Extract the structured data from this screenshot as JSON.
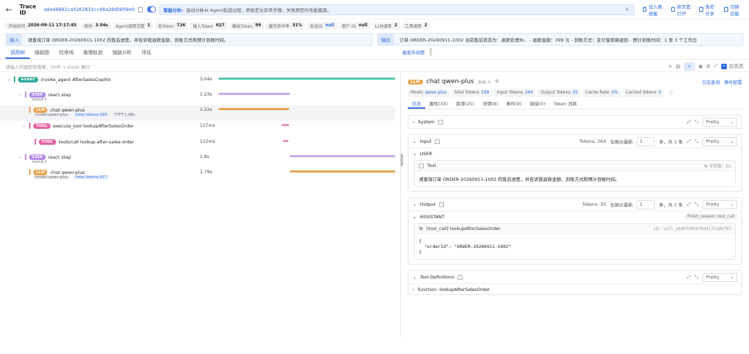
{
  "header": {
    "trace_label": "Trace ID",
    "trace_id": "a8a46682ca5162833cc06a28d5050e9",
    "ai_title": "智能分析:",
    "ai_text": "自动分析AI Agent轨迹过程，帮助定位异常步骤，失败原因与性能瓶颈。",
    "actions": [
      "加入数据集",
      "新页面打开",
      "免密分享",
      "切换旧版"
    ]
  },
  "stats": [
    {
      "label": "开始时间",
      "value": "2026-09-11 17:17:45"
    },
    {
      "label": "耗时",
      "value": "3.04s"
    },
    {
      "label": "Agent调用次数",
      "value": "1"
    },
    {
      "label": "总Token",
      "value": "726"
    },
    {
      "label": "输入Token",
      "value": "627"
    },
    {
      "label": "输出Token",
      "value": "99"
    },
    {
      "label": "缓存命中率",
      "value": "31%"
    },
    {
      "label": "会话ID",
      "value": "null"
    },
    {
      "label": "用户 ID",
      "value": "null"
    },
    {
      "label": "LLM调用",
      "value": "2"
    },
    {
      "label": "工具调用",
      "value": "2"
    }
  ],
  "io": {
    "input_tag": "输入",
    "input_text": "请查询订单 ORDER-20260911-1002 的售后进度，并告诉我退款金额、到账方式和预计到账时间。",
    "output_tag": "输出",
    "output_text": "订单 ORDER-20260911-1002 当前售后状态为：退款处理中。 - 退款金额：399 元 - 到账方式：支付宝原路退回 - 预计到账时间：1 至 3 个工作日"
  },
  "tabs": [
    "调用树",
    "链路图",
    "时序线",
    "推理轨迹",
    "链路分析",
    "评估"
  ],
  "tabs_right": "偏爱布视图",
  "search": {
    "placeholder": "请输入内容回车搜索，Shift + Enter 换行",
    "toggle_label": "仅高亮"
  },
  "tree": [
    {
      "type": "AGENT",
      "name": "invoke_agent AfterSalesCopilot",
      "dur": "3.04s"
    },
    {
      "type": "STEP",
      "name": "react step",
      "sub": "round:1",
      "dur": "1.23s"
    },
    {
      "type": "LLM",
      "name": "chat qwen-plus",
      "model": "model:qwen-plus",
      "tokens": "total tokens:299",
      "ttft": "TTFT:1.08s",
      "dur": "1.22s"
    },
    {
      "type": "TOOL",
      "name": "execute_tool lookupAfterSalesOrder",
      "dur": "127ms"
    },
    {
      "type": "TOOL",
      "name": "tools/call lookup-after-sales-order",
      "dur": "112ms"
    },
    {
      "type": "STEP",
      "name": "react step",
      "sub": "round:2",
      "dur": "1.8s"
    },
    {
      "type": "LLM",
      "name": "chat qwen-plus",
      "model": "model:qwen-plus",
      "tokens": "total tokens:427",
      "dur": "1.79s"
    }
  ],
  "detail": {
    "badge": "LLM",
    "title": "chat qwen-plus",
    "alias": "别名",
    "links": [
      "日志查询",
      "事件配置"
    ],
    "metrics": [
      {
        "label": "Model",
        "value": "qwen-plus"
      },
      {
        "label": "Total Tokens",
        "value": "299"
      },
      {
        "label": "Input Tokens",
        "value": "264"
      },
      {
        "label": "Output Tokens",
        "value": "35"
      },
      {
        "label": "Cache Rate",
        "value": "0%"
      },
      {
        "label": "Cached Tokens",
        "value": "0"
      }
    ],
    "tabs": [
      "信息",
      "属性(33)",
      "资源(25)",
      "详情(8)",
      "事件(0)",
      "链接(0)",
      "Token 消耗"
    ],
    "pretty": "Pretty",
    "system_label": "System",
    "input_label": "Input",
    "input_tokens": "Tokens: 264",
    "show_latest": "仅展示最新",
    "input_count": "1",
    "input_suffix": "条，共 1 条",
    "user_role": "USER",
    "text_label": "Text",
    "char_count": "字符数：53",
    "user_text": "请查询订单 ORDER-20260911-1002 的售后进度，并告诉我退款金额、到账方式和预计到账时间。",
    "output_label": "Output",
    "output_tokens": "Tokens: 35",
    "output_count": "1",
    "output_suffix": "条，共 1 条",
    "assistant_role": "ASSISTANT",
    "finish_reason": "finish_reason: tool_call",
    "tool_call_label": "[tool_call] lookupAfterSalesOrder",
    "tool_call_id": "id: call_e6db7595b76d4171ad6f93",
    "tool_call_body": "{\n  \"orderId\": \"ORDER-20260911-1002\"\n}",
    "tool_defs_label": "Tool Definitions",
    "tool_def_item": "function: lookupAfterSalesOrder"
  }
}
